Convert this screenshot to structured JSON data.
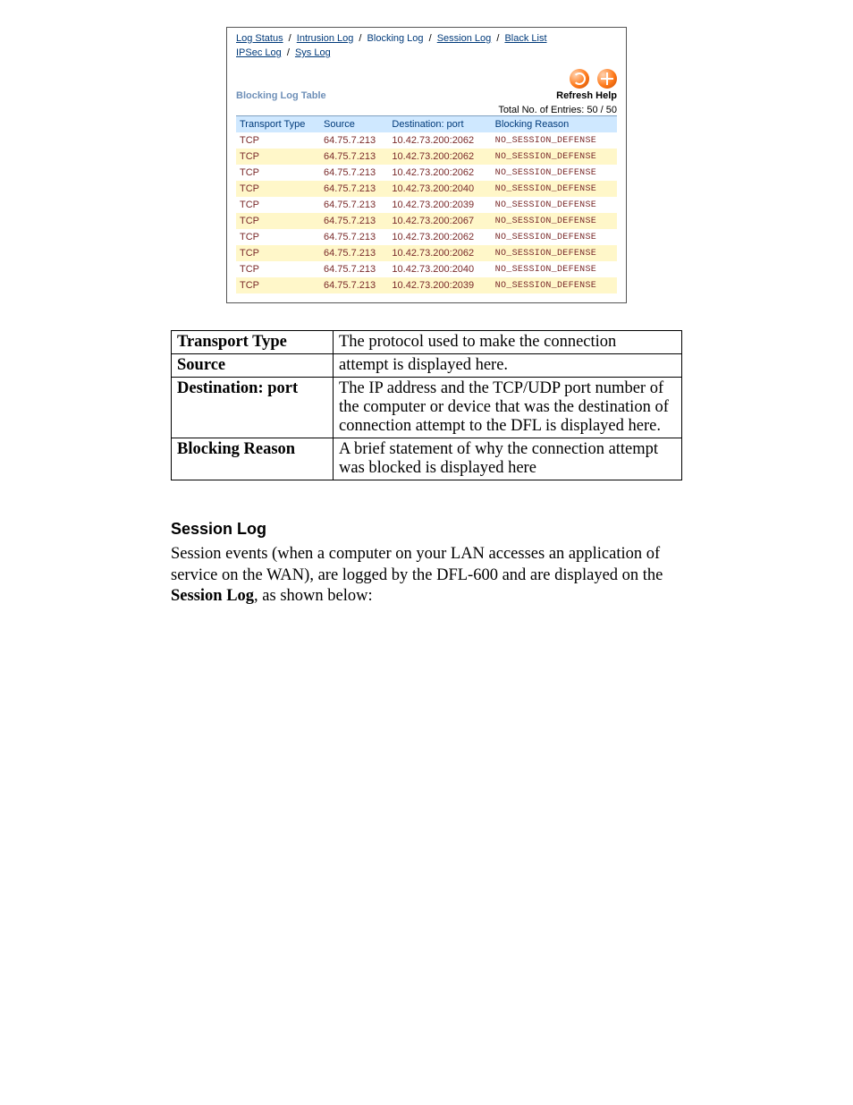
{
  "nav": {
    "items": [
      {
        "label": "Log Status",
        "link": true
      },
      {
        "label": "Intrusion Log",
        "link": true
      },
      {
        "label": "Blocking Log",
        "link": false
      },
      {
        "label": "Session Log",
        "link": true
      },
      {
        "label": "Black List",
        "link": true
      }
    ],
    "row2": [
      {
        "label": "IPSec Log",
        "link": true
      },
      {
        "label": "Sys Log",
        "link": true
      }
    ],
    "sep": " / "
  },
  "actions": {
    "refresh_label": "Refresh",
    "help_label": "Help"
  },
  "section_title": "Blocking Log Table",
  "entries_text": "Total No. of Entries: 50  /  50",
  "columns": {
    "c1": "Transport Type",
    "c2": "Source",
    "c3": "Destination: port",
    "c4": "Blocking Reason"
  },
  "rows": [
    {
      "t": "TCP",
      "s": "64.75.7.213",
      "d": "10.42.73.200:2062",
      "r": "NO_SESSION_DEFENSE"
    },
    {
      "t": "TCP",
      "s": "64.75.7.213",
      "d": "10.42.73.200:2062",
      "r": "NO_SESSION_DEFENSE"
    },
    {
      "t": "TCP",
      "s": "64.75.7.213",
      "d": "10.42.73.200:2062",
      "r": "NO_SESSION_DEFENSE"
    },
    {
      "t": "TCP",
      "s": "64.75.7.213",
      "d": "10.42.73.200:2040",
      "r": "NO_SESSION_DEFENSE"
    },
    {
      "t": "TCP",
      "s": "64.75.7.213",
      "d": "10.42.73.200:2039",
      "r": "NO_SESSION_DEFENSE"
    },
    {
      "t": "TCP",
      "s": "64.75.7.213",
      "d": "10.42.73.200:2067",
      "r": "NO_SESSION_DEFENSE"
    },
    {
      "t": "TCP",
      "s": "64.75.7.213",
      "d": "10.42.73.200:2062",
      "r": "NO_SESSION_DEFENSE"
    },
    {
      "t": "TCP",
      "s": "64.75.7.213",
      "d": "10.42.73.200:2062",
      "r": "NO_SESSION_DEFENSE"
    },
    {
      "t": "TCP",
      "s": "64.75.7.213",
      "d": "10.42.73.200:2040",
      "r": "NO_SESSION_DEFENSE"
    },
    {
      "t": "TCP",
      "s": "64.75.7.213",
      "d": "10.42.73.200:2039",
      "r": "NO_SESSION_DEFENSE"
    }
  ],
  "desc": [
    {
      "k": "Transport Type",
      "v": "The protocol used to make the connection"
    },
    {
      "k": "Source",
      "v": "attempt is displayed here."
    },
    {
      "k": "Destination: port",
      "v": "The IP address and the TCP/UDP port number of the computer or device that was the destination of connection attempt to the DFL is displayed here."
    },
    {
      "k": "Blocking Reason",
      "v": "A brief statement of why the connection attempt was blocked is displayed here"
    }
  ],
  "body": {
    "heading": "Session Log",
    "p1a": "Session events (when a computer on your LAN accesses an application of service on the WAN), are logged by the DFL-600 and are displayed on the ",
    "p1bold": "Session Log",
    "p1b": ", as shown below:"
  }
}
